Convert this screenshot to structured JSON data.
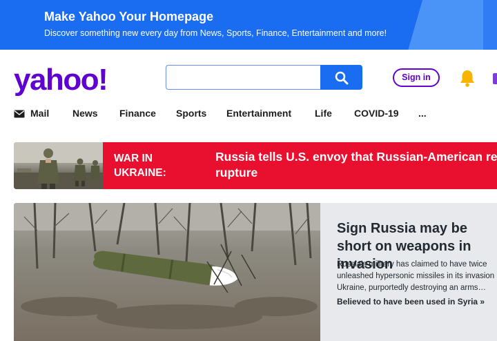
{
  "promo": {
    "title": "Make Yahoo Your Homepage",
    "subtitle": "Discover something new every day from News, Sports, Finance, Entertainment and more!"
  },
  "header": {
    "logo_text": "yahoo!",
    "search_placeholder": "",
    "signin_label": "Sign in"
  },
  "nav": {
    "items": [
      "Mail",
      "News",
      "Finance",
      "Sports",
      "Entertainment",
      "Life",
      "COVID-19",
      "..."
    ]
  },
  "war_banner": {
    "kicker_line1": "WAR IN",
    "kicker_line2": "UKRAINE:",
    "headline_line1": "Russia tells U.S. envoy that Russian-American rel",
    "headline_line2": "rupture"
  },
  "hero": {
    "title": "Sign Russia may be short on weapons in invasion",
    "summary": "Russia's military has claimed to have twice\nunleashed hypersonic missiles in its invasion\nUkraine, purportedly destroying an arms…",
    "related": "Believed to have been used in Syria »"
  },
  "colors": {
    "brand_purple": "#6001d2",
    "promo_blue": "#1a6cf0",
    "war_red": "#e8102e",
    "bell_yellow": "#f6b400"
  }
}
